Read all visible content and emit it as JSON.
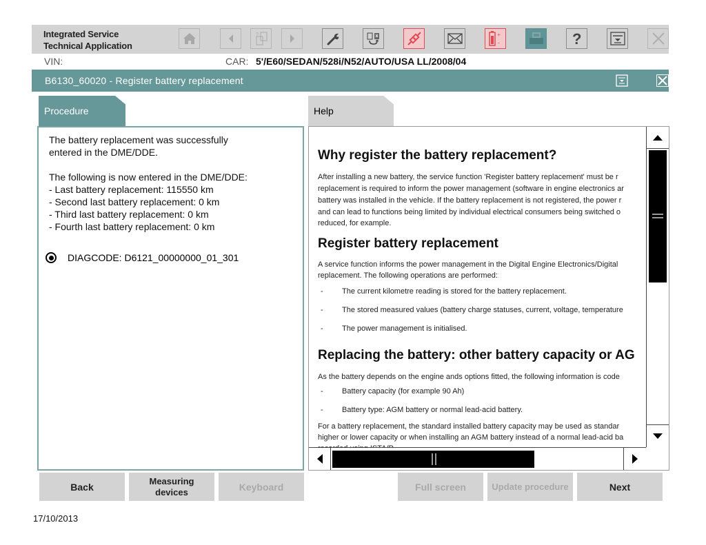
{
  "app": {
    "title_line1": "Integrated Service",
    "title_line2": "Technical Application"
  },
  "toolbar": {
    "buttons": [
      {
        "name": "home",
        "icon": "home-icon",
        "state": "disabled"
      },
      {
        "name": "back",
        "icon": "arrow-left-icon",
        "state": "disabled"
      },
      {
        "name": "documents",
        "icon": "documents-icon",
        "state": "disabled"
      },
      {
        "name": "forward",
        "icon": "arrow-right-icon",
        "state": "disabled"
      },
      {
        "name": "service-functions",
        "icon": "wrench-icon",
        "state": "enabled"
      },
      {
        "name": "vehicle-connection",
        "icon": "connection-swap-icon",
        "state": "enabled"
      },
      {
        "name": "connection-status",
        "icon": "plug-disconnected-icon",
        "state": "alert"
      },
      {
        "name": "messages",
        "icon": "envelope-icon",
        "state": "enabled"
      },
      {
        "name": "battery-status",
        "icon": "battery-icon",
        "state": "alert"
      },
      {
        "name": "print",
        "icon": "printer-icon",
        "state": "active"
      },
      {
        "name": "help",
        "icon": "question-icon",
        "state": "enabled"
      },
      {
        "name": "minimize",
        "icon": "minimize-window-icon",
        "state": "enabled"
      },
      {
        "name": "close",
        "icon": "close-icon",
        "state": "disabled"
      }
    ]
  },
  "vehicle": {
    "vin_label": "VIN:",
    "vin_value": "",
    "car_label": "CAR:",
    "car_value": "5'/E60/SEDAN/528i/N52/AUTO/USA LL/2008/04"
  },
  "window": {
    "title": "B6130_60020 - Register battery replacement"
  },
  "tabs": {
    "procedure": "Procedure",
    "help": "Help"
  },
  "procedure": {
    "line1": "The battery replacement was successfully",
    "line2": "entered in the DME/DDE.",
    "line3": "The following is now entered in the DME/DDE:",
    "items": [
      "- Last battery replacement: 115550 km",
      "- Second last battery replacement: 0 km",
      "- Third last battery replacement: 0 km",
      "- Fourth last battery replacement: 0 km"
    ],
    "diagcode": "DIAGCODE: D6121_00000000_01_301"
  },
  "help": {
    "h1": "Why register the battery replacement?",
    "p1": [
      "After installing a new battery, the service function 'Register battery replacement' must be r",
      "replacement is required to inform the power management (software in engine electronics ar",
      "battery was installed in the vehicle. If the battery replacement is not registered, the power r",
      "and can lead to functions being limited by individual electrical consumers being switched o",
      "reduced, for example."
    ],
    "h2": "Register battery replacement",
    "p2": [
      "A service function informs the power management in the Digital Engine Electronics/Digital",
      "replacement. The following operations are performed:"
    ],
    "list2": [
      "The current kilometre reading is stored for the battery replacement.",
      "The stored measured values (battery charge statuses, current, voltage, temperature",
      "The power management is initialised."
    ],
    "h3": "Replacing the battery: other battery capacity or AG",
    "p3": "As the battery depends on the engine ands options fitted, the following information is code",
    "list3": [
      "Battery capacity (for example 90 Ah)",
      "Battery type: AGM battery or normal lead-acid battery."
    ],
    "p4": [
      "For a battery replacement, the standard installed battery capacity may be used as standar",
      "higher or lower capacity or when installing an AGM battery instead of a normal lead-acid ba",
      "recorded using ISTA/P."
    ],
    "dash": "-",
    "vertical_scroll_position": 0.4,
    "horizontal_scroll_position": 0.0
  },
  "buttons": {
    "back": "Back",
    "measuring": "Measuring devices",
    "keyboard": "Keyboard",
    "fullscreen": "Full screen",
    "update": "Update procedure",
    "next": "Next"
  },
  "footer": {
    "date": "17/10/2013"
  },
  "colors": {
    "teal": "#669799",
    "toolbar_gray": "#d3d3d3",
    "alert_red": "#e04a55"
  }
}
